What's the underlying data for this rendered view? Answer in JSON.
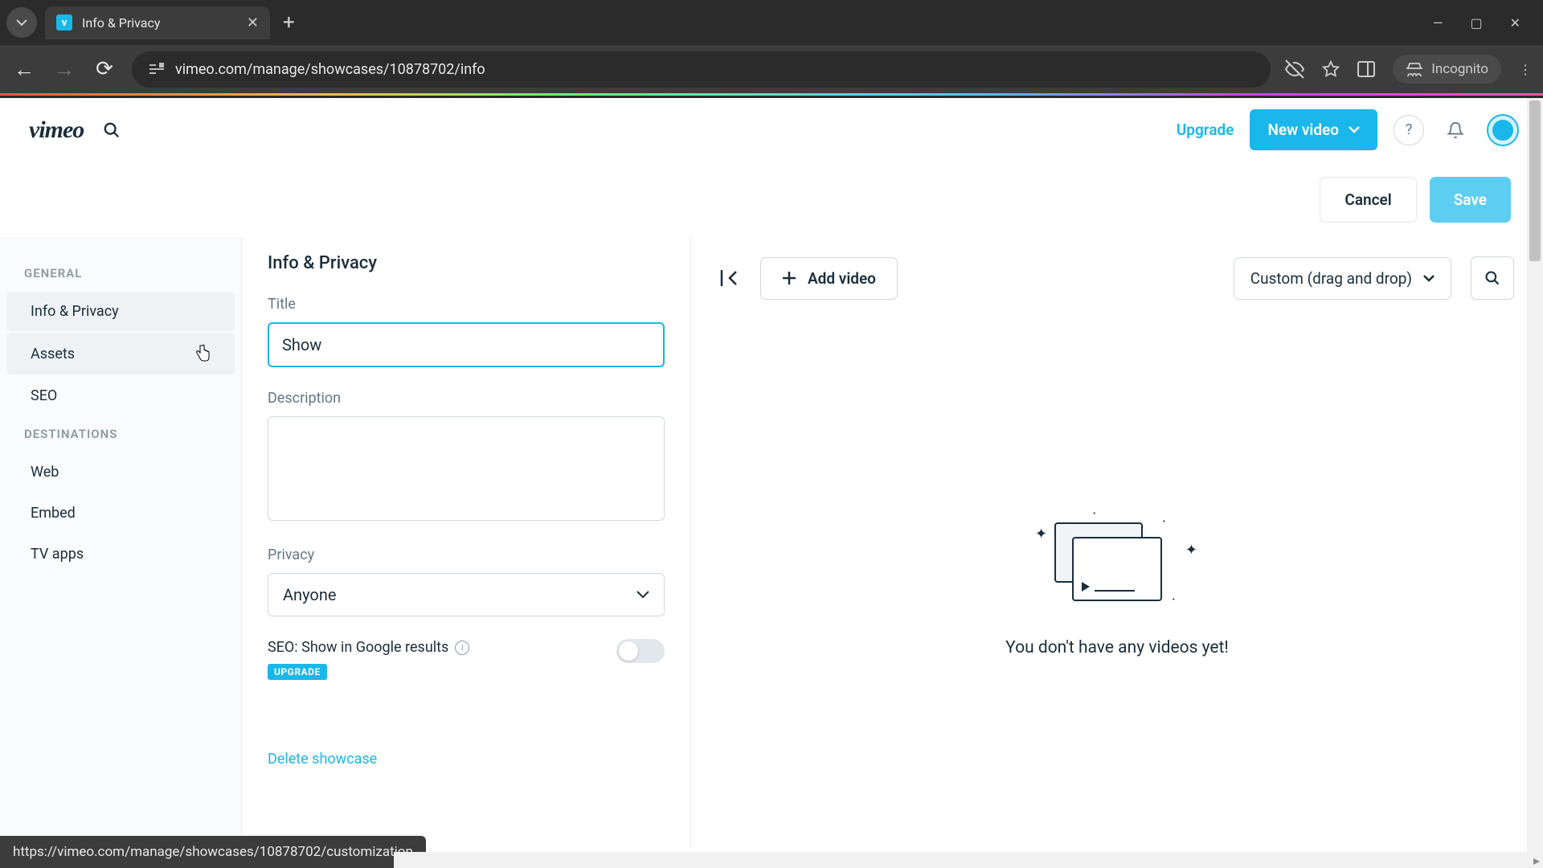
{
  "browser": {
    "tab_title": "Info & Privacy",
    "url": "vimeo.com/manage/showcases/10878702/info",
    "incognito_label": "Incognito",
    "status_url": "https://vimeo.com/manage/showcases/10878702/customization"
  },
  "header": {
    "logo": "vimeo",
    "upgrade": "Upgrade",
    "new_video": "New video"
  },
  "actions": {
    "cancel": "Cancel",
    "save": "Save"
  },
  "sidebar": {
    "section1": "GENERAL",
    "items1": [
      "Info & Privacy",
      "Assets",
      "SEO"
    ],
    "section2": "DESTINATIONS",
    "items2": [
      "Web",
      "Embed",
      "TV apps"
    ]
  },
  "form": {
    "heading": "Info & Privacy",
    "title_label": "Title",
    "title_value": "Show",
    "description_label": "Description",
    "description_value": "",
    "privacy_label": "Privacy",
    "privacy_value": "Anyone",
    "seo_label": "SEO: Show in Google results",
    "upgrade_badge": "UPGRADE",
    "delete_link": "Delete showcase"
  },
  "videos": {
    "add_button": "Add video",
    "sort_value": "Custom (drag and drop)",
    "empty_text": "You don't have any videos yet!"
  }
}
